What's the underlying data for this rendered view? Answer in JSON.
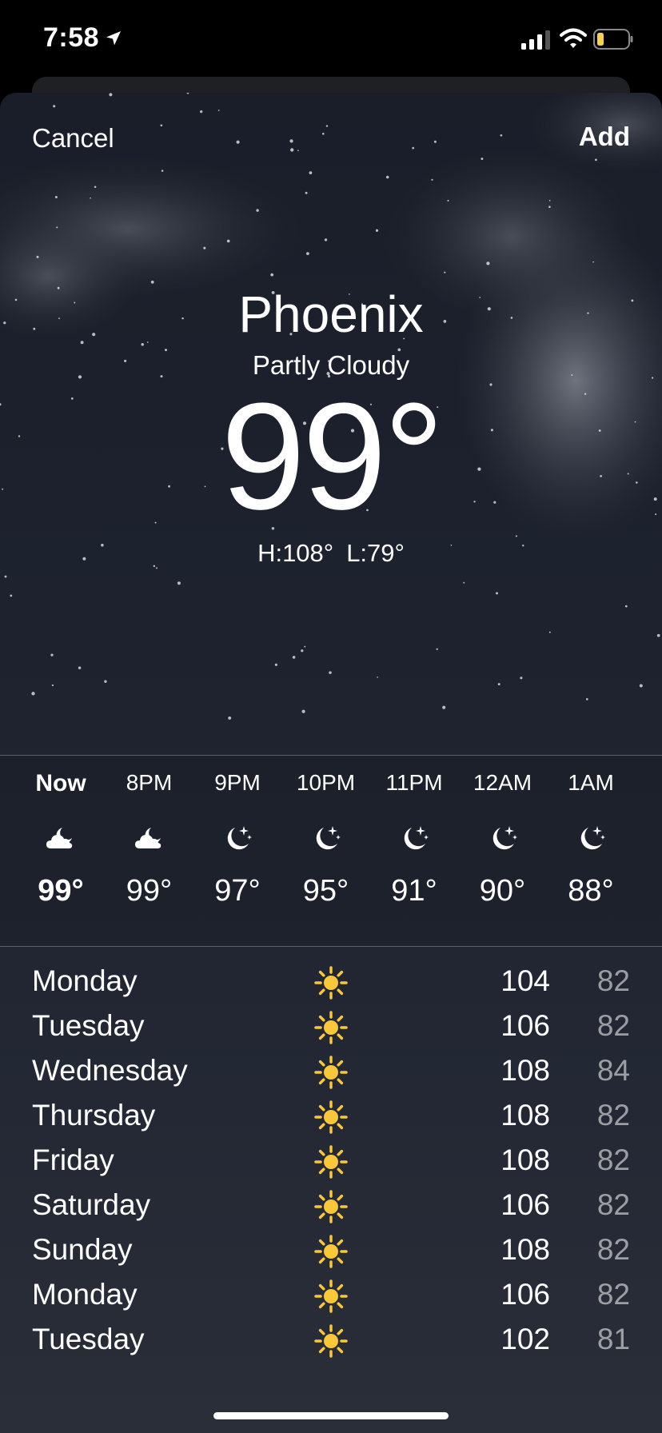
{
  "status_bar": {
    "time": "7:58",
    "icons": [
      "location-arrow-icon",
      "cellular-signal-icon",
      "wifi-icon",
      "battery-low-icon"
    ],
    "battery_color": "#f7d34a"
  },
  "nav": {
    "cancel_label": "Cancel",
    "add_label": "Add"
  },
  "current": {
    "city": "Phoenix",
    "condition": "Partly Cloudy",
    "temperature": "99°",
    "high": "H:108°",
    "low": "L:79°"
  },
  "hourly": [
    {
      "time": "Now",
      "icon": "cloud-moon-icon",
      "temp": "99°"
    },
    {
      "time": "8PM",
      "icon": "cloud-moon-icon",
      "temp": "99°"
    },
    {
      "time": "9PM",
      "icon": "moon-stars-icon",
      "temp": "97°"
    },
    {
      "time": "10PM",
      "icon": "moon-stars-icon",
      "temp": "95°"
    },
    {
      "time": "11PM",
      "icon": "moon-stars-icon",
      "temp": "91°"
    },
    {
      "time": "12AM",
      "icon": "moon-stars-icon",
      "temp": "90°"
    },
    {
      "time": "1AM",
      "icon": "moon-stars-icon",
      "temp": "88°"
    }
  ],
  "daily": [
    {
      "day": "Monday",
      "icon": "sun-icon",
      "high": "104",
      "low": "82"
    },
    {
      "day": "Tuesday",
      "icon": "sun-icon",
      "high": "106",
      "low": "82"
    },
    {
      "day": "Wednesday",
      "icon": "sun-icon",
      "high": "108",
      "low": "84"
    },
    {
      "day": "Thursday",
      "icon": "sun-icon",
      "high": "108",
      "low": "82"
    },
    {
      "day": "Friday",
      "icon": "sun-icon",
      "high": "108",
      "low": "82"
    },
    {
      "day": "Saturday",
      "icon": "sun-icon",
      "high": "106",
      "low": "82"
    },
    {
      "day": "Sunday",
      "icon": "sun-icon",
      "high": "108",
      "low": "82"
    },
    {
      "day": "Monday",
      "icon": "sun-icon",
      "high": "106",
      "low": "82"
    },
    {
      "day": "Tuesday",
      "icon": "sun-icon",
      "high": "102",
      "low": "81"
    }
  ],
  "colors": {
    "sun": "#f8c83a",
    "low_temp": "rgba(255,255,255,0.55)",
    "sky_top": "#1a1e29"
  }
}
